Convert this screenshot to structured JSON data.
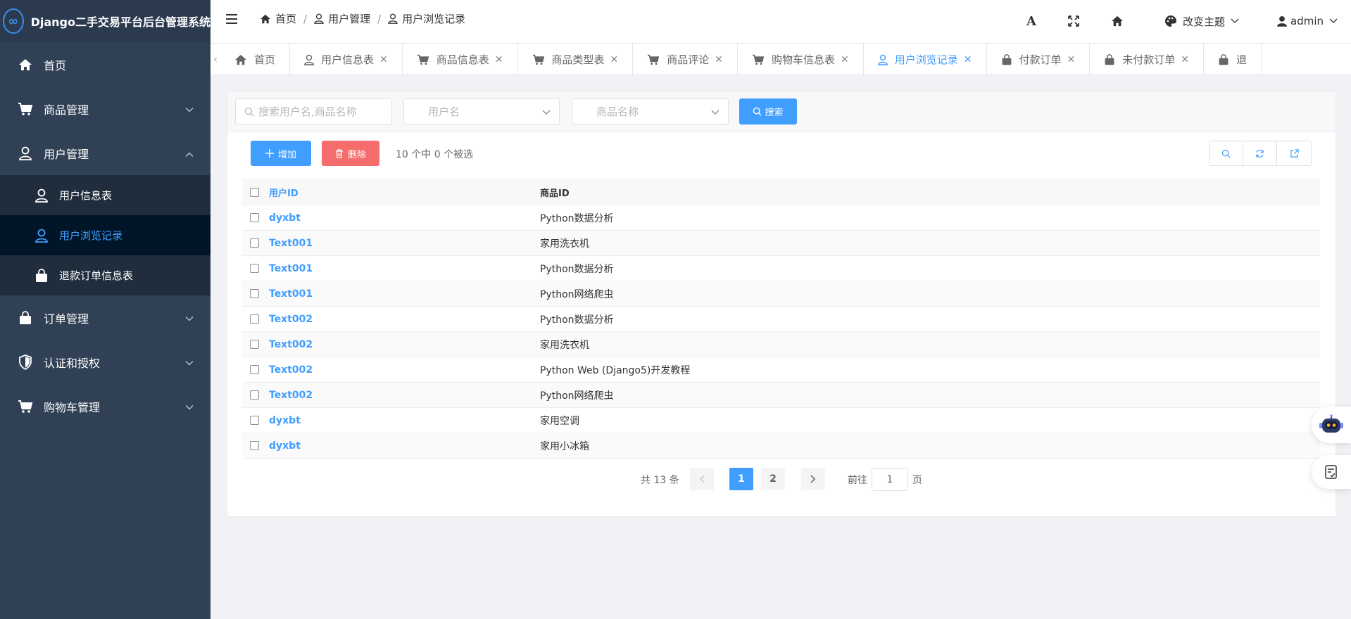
{
  "sidebar": {
    "title": "Django二手交易平台后台管理系统",
    "logo_symbol": "∞",
    "items": [
      {
        "label": "首页",
        "icon": "home-icon"
      },
      {
        "label": "商品管理",
        "icon": "cart-icon"
      },
      {
        "label": "用户管理",
        "icon": "user-icon"
      },
      {
        "label": "订单管理",
        "icon": "bag-icon"
      },
      {
        "label": "认证和授权",
        "icon": "shield-icon"
      },
      {
        "label": "购物车管理",
        "icon": "cart-icon"
      }
    ],
    "sub_items": [
      {
        "label": "用户信息表",
        "icon": "user-icon"
      },
      {
        "label": "用户浏览记录",
        "icon": "user-icon",
        "active": true
      },
      {
        "label": "退款订单信息表",
        "icon": "bag-icon"
      }
    ]
  },
  "header": {
    "breadcrumb": [
      "首页",
      "用户管理",
      "用户浏览记录"
    ],
    "breadcrumb_sep": "/",
    "font_button": "A",
    "theme_label": "改变主题",
    "user_label": "admin"
  },
  "tabs": [
    {
      "label": "首页",
      "icon": "home-icon",
      "closable": false
    },
    {
      "label": "用户信息表",
      "icon": "user-icon",
      "closable": true
    },
    {
      "label": "商品信息表",
      "icon": "cart-icon",
      "closable": true
    },
    {
      "label": "商品类型表",
      "icon": "cart-icon",
      "closable": true
    },
    {
      "label": "商品评论",
      "icon": "cart-icon",
      "closable": true
    },
    {
      "label": "购物车信息表",
      "icon": "cart-icon",
      "closable": true
    },
    {
      "label": "用户浏览记录",
      "icon": "user-icon",
      "closable": true,
      "active": true
    },
    {
      "label": "付款订单",
      "icon": "bag-icon",
      "closable": true
    },
    {
      "label": "未付款订单",
      "icon": "bag-icon",
      "closable": true
    },
    {
      "label": "退",
      "icon": "bag-icon",
      "closable": false
    }
  ],
  "search": {
    "keyword_placeholder": "搜索用户名,商品名称",
    "user_select_placeholder": "用户名",
    "goods_select_placeholder": "商品名称",
    "button_label": "搜索"
  },
  "toolbar": {
    "add_label": "增加",
    "delete_label": "删除",
    "selection_info": "10 个中 0 个被选"
  },
  "table": {
    "columns": [
      "用户ID",
      "商品ID"
    ],
    "rows": [
      {
        "user": "dyxbt",
        "goods": "Python数据分析"
      },
      {
        "user": "Text001",
        "goods": "家用洗衣机"
      },
      {
        "user": "Text001",
        "goods": "Python数据分析"
      },
      {
        "user": "Text001",
        "goods": "Python网络爬虫"
      },
      {
        "user": "Text002",
        "goods": "Python数据分析"
      },
      {
        "user": "Text002",
        "goods": "家用洗衣机"
      },
      {
        "user": "Text002",
        "goods": "Python Web (Django5)开发教程"
      },
      {
        "user": "Text002",
        "goods": "Python网络爬虫"
      },
      {
        "user": "dyxbt",
        "goods": "家用空调"
      },
      {
        "user": "dyxbt",
        "goods": "家用小冰箱"
      }
    ]
  },
  "pagination": {
    "total_text": "共 13 条",
    "pages": [
      "1",
      "2"
    ],
    "current_page": 1,
    "goto_label": "前往",
    "goto_value": "1",
    "page_unit": "页"
  },
  "colors": {
    "primary": "#409eff",
    "danger": "#f56c6c",
    "sidebar_bg": "#304156",
    "sidebar_active_bg": "#001528"
  }
}
